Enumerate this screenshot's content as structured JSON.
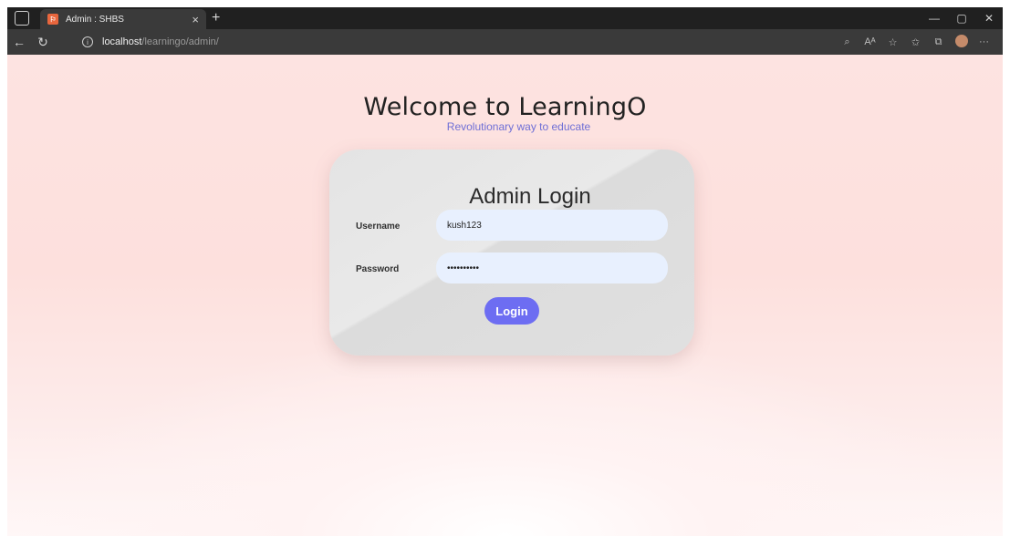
{
  "browser": {
    "tab_title": "Admin : SHBS",
    "tab_close": "×",
    "new_tab": "+",
    "url_host": "localhost",
    "url_path": "/learningo/admin/",
    "window_controls": {
      "minimize": "—",
      "restore": "▢",
      "close": "✕"
    },
    "toolbar_icons": [
      "search-page-icon",
      "read-aloud-icon",
      "add-favorite-icon",
      "favorites-icon",
      "collections-icon",
      "profile-avatar-icon",
      "more-icon"
    ]
  },
  "page": {
    "heading": "Welcome to LearningO",
    "subheading": "Revolutionary way to educate",
    "card": {
      "title": "Admin Login",
      "username_label": "Username",
      "username_value": "kush123",
      "password_label": "Password",
      "password_value": "••••••••••",
      "login_label": "Login"
    }
  },
  "colors": {
    "accent": "#6d6df2",
    "subheading": "#6f6fd6",
    "input_bg": "#e8f0fe",
    "page_bg": "#fde3e1"
  }
}
